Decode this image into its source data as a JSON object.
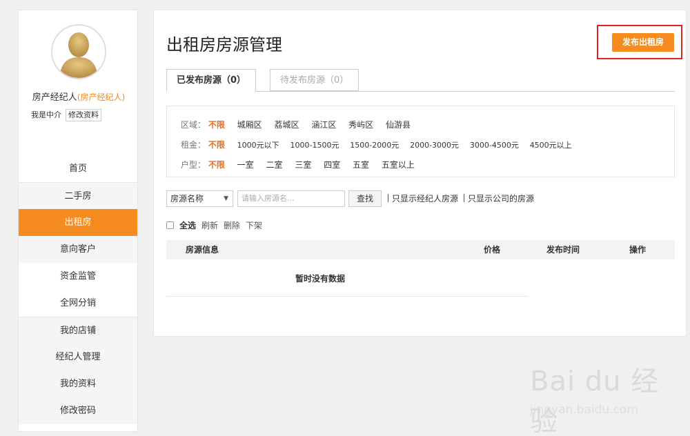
{
  "profile": {
    "name": "房产经纪人",
    "role": "(房产经纪人)",
    "desc": "我是中介",
    "edit_label": "修改资料",
    "avatar_icon": "user-avatar-icon"
  },
  "nav": {
    "items": [
      {
        "label": "首页"
      },
      {
        "label": "二手房"
      },
      {
        "label": "出租房"
      },
      {
        "label": "意向客户"
      },
      {
        "label": "资金监管"
      },
      {
        "label": "全网分销"
      },
      {
        "label": "我的店铺"
      },
      {
        "label": "经纪人管理"
      },
      {
        "label": "我的资料"
      },
      {
        "label": "修改密码"
      }
    ],
    "active_index": 2,
    "active_color": "#f68b1f"
  },
  "page": {
    "title": "出租房房源管理",
    "publish_label": "发布出租房",
    "highlight_color": "#e02020"
  },
  "tabs": [
    {
      "label": "已发布房源（0）"
    },
    {
      "label": "待发布房源（0）"
    }
  ],
  "filters": {
    "area": {
      "label": "区域：",
      "options": [
        "不限",
        "城厢区",
        "荔城区",
        "涵江区",
        "秀屿区",
        "仙游县"
      ]
    },
    "rent": {
      "label": "租金：",
      "options": [
        "不限",
        "1000元以下",
        "1000-1500元",
        "1500-2000元",
        "2000-3000元",
        "3000-4500元",
        "4500元以上"
      ]
    },
    "layout": {
      "label": "户型：",
      "options": [
        "不限",
        "一室",
        "二室",
        "三室",
        "四室",
        "五室",
        "五室以上"
      ]
    }
  },
  "search": {
    "select_value": "房源名称",
    "placeholder": "请输入房源名...",
    "button_label": "查找",
    "link_agent": "只显示经纪人房源",
    "link_company": "只显示公司的房源"
  },
  "actions": {
    "select_all": "全选",
    "refresh": "刷新",
    "delete": "删除",
    "unlist": "下架"
  },
  "table": {
    "headers": [
      "房源信息",
      "价格",
      "发布时间",
      "操作"
    ],
    "empty_text": "暂时没有数据"
  },
  "watermark": {
    "logo": "Bai du 经验",
    "url": "jingyan.baidu.com"
  }
}
